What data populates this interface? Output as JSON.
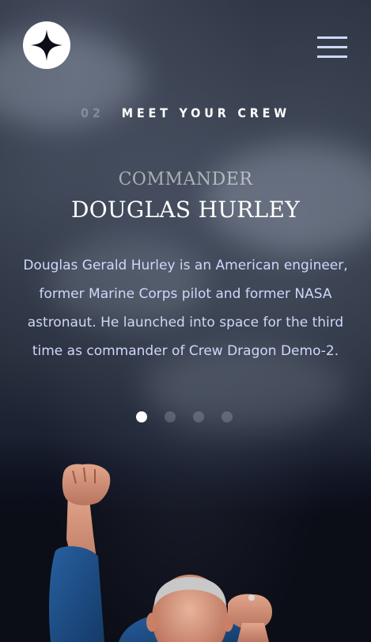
{
  "header": {
    "logo_icon": "star-icon",
    "menu_icon": "hamburger-icon"
  },
  "section": {
    "number": "02",
    "title": "MEET YOUR CREW"
  },
  "crew": {
    "role": "COMMANDER",
    "name": "DOUGLAS HURLEY",
    "bio": "Douglas Gerald Hurley is an American engineer, former Marine Corps pilot and former NASA astronaut. He launched into space for the third time as commander of Crew Dragon Demo-2."
  },
  "pagination": {
    "count": 4,
    "active_index": 0
  },
  "colors": {
    "background": "#0b0d17",
    "accent": "#d0d6f9",
    "text": "#ffffff",
    "shirt": "#1d4f8a"
  }
}
